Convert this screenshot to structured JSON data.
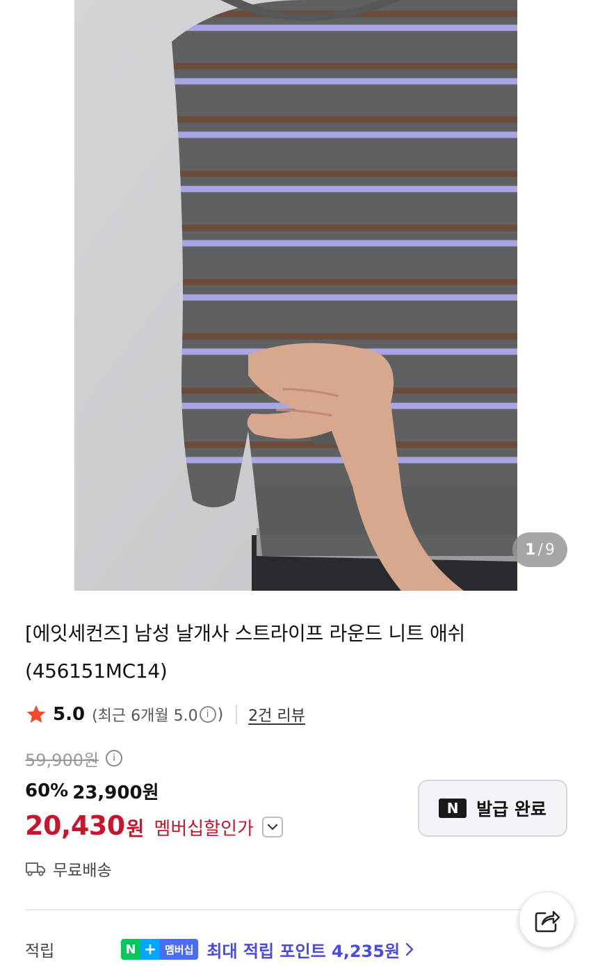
{
  "gallery": {
    "image_alt": "grey striped knit sweater photo",
    "current": "1",
    "separator": "/",
    "total": "9"
  },
  "product": {
    "title": "[에잇세컨즈] 남성 날개사 스트라이프 라운드 니트 애쉬 (456151MC14)"
  },
  "rating": {
    "value": "5.0",
    "recent_text": "(최근 6개월 5.0",
    "recent_close": ")",
    "review_link": "2건 리뷰"
  },
  "price": {
    "original": "59,900원",
    "discount_percent": "60%",
    "discount_price": "23,900원",
    "member_price": "20,430",
    "member_won": "원",
    "member_label": "멤버십할인가"
  },
  "coupon": {
    "badge": "N",
    "label": "발급 완료"
  },
  "shipping": {
    "label": "무료배송"
  },
  "points": {
    "label": "적립",
    "badge_n": "N",
    "badge_plus": "+",
    "badge_membership": "멤버십",
    "text": "최대 적립 포인트 4,235원"
  },
  "colors": {
    "sale_red": "#c7162b",
    "points_blue": "#4a49e0",
    "naver_green": "#03c75a"
  }
}
